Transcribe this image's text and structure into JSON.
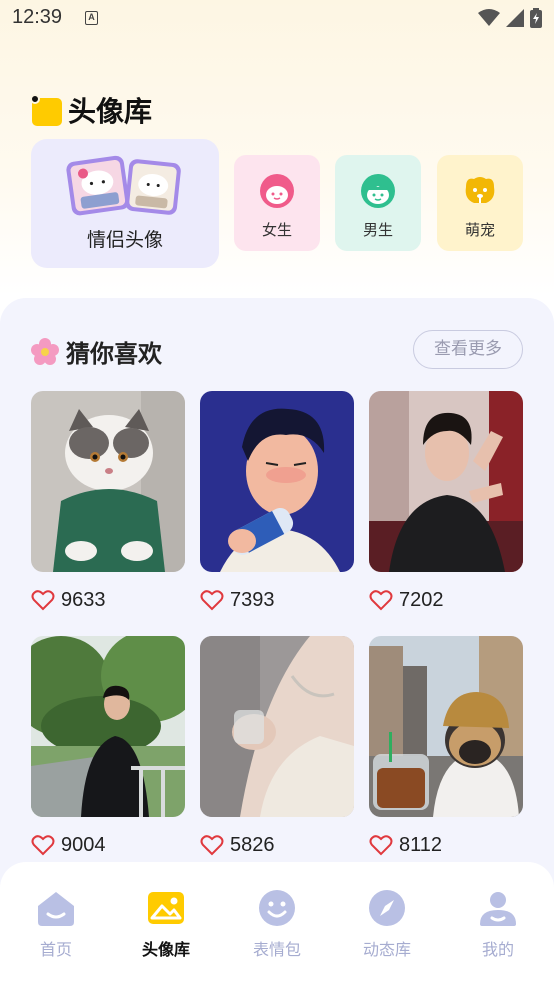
{
  "status_bar": {
    "time": "12:39",
    "notification_letter": "A"
  },
  "header": {
    "title": "头像库"
  },
  "categories": {
    "couple": "情侣头像",
    "girl": "女生",
    "boy": "男生",
    "pet": "萌宠"
  },
  "recommend": {
    "title": "猜你喜欢",
    "more_label": "查看更多",
    "items": [
      {
        "subject": "white persian cat in green sweater",
        "likes": "9633"
      },
      {
        "subject": "illustrated boy drinking can",
        "likes": "7393"
      },
      {
        "subject": "young man in black tee at cafe",
        "likes": "7202"
      },
      {
        "subject": "man leaning on railing in park",
        "likes": "9004"
      },
      {
        "subject": "woman holding glass",
        "likes": "5826"
      },
      {
        "subject": "pug in beanie with iced coffee",
        "likes": "8112"
      }
    ]
  },
  "bottom_nav": [
    {
      "label": "首页",
      "icon": "home-icon",
      "active": false
    },
    {
      "label": "头像库",
      "icon": "gallery-icon",
      "active": true
    },
    {
      "label": "表情包",
      "icon": "smiley-icon",
      "active": false
    },
    {
      "label": "动态库",
      "icon": "compass-icon",
      "active": false
    },
    {
      "label": "我的",
      "icon": "profile-icon",
      "active": false
    }
  ],
  "colors": {
    "accent_yellow": "#ffcb00",
    "nav_inactive": "#a6acd0",
    "heart": "#e0393e",
    "panel_bg": "#f3f4fd"
  }
}
